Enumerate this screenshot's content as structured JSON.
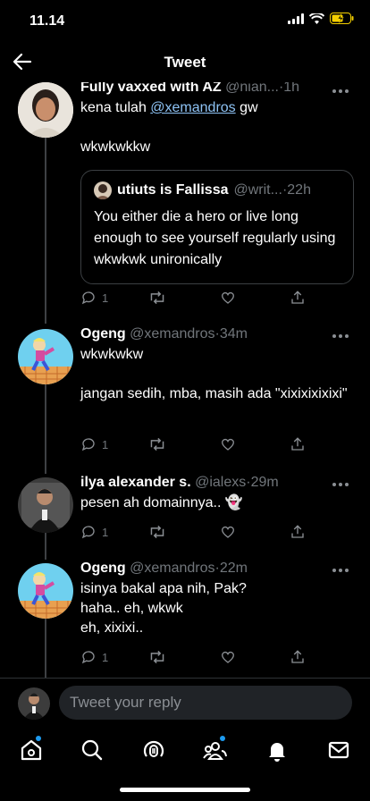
{
  "status_bar": {
    "time": "11.14",
    "battery_color": "#f5d000"
  },
  "header": {
    "title": "Tweet"
  },
  "tweets": [
    {
      "name": "Fully vaxxed with AZ",
      "handle": "@nian...",
      "sep": "·",
      "time": "1h",
      "text_before": "kena tulah ",
      "mention": "@xemandros",
      "text_after": " gw",
      "text2": "wkwkwkkw",
      "quote": {
        "name": "utiuts is Fallissa",
        "handle": "@writ...",
        "sep": "·",
        "time": "22h",
        "text": "You either die a hero or live long enough to see yourself regularly using wkwkwk unironically"
      },
      "reply_count": "1"
    },
    {
      "name": "Ogeng",
      "handle": "@xemandros",
      "sep": "·",
      "time": "34m",
      "text": "wkwkwkw\n\njangan sedih, mba, masih ada \"xixixixixixi\"",
      "reply_count": "1"
    },
    {
      "name": "ilya alexander s.",
      "handle": "@ialexs",
      "sep": "·",
      "time": "29m",
      "text": "pesen ah domainnya.. 👻",
      "reply_count": "1"
    },
    {
      "name": "Ogeng",
      "handle": "@xemandros",
      "sep": "·",
      "time": "22m",
      "text": "isinya bakal apa nih, Pak?\nhaha.. eh, wkwk\neh, xixixi..",
      "reply_count": "1"
    }
  ],
  "reply": {
    "placeholder": "Tweet your reply"
  },
  "tabs": [
    "home-icon",
    "search-icon",
    "spaces-icon",
    "communities-icon",
    "notifications-icon",
    "messages-icon"
  ],
  "accent": "#1d9bf0"
}
